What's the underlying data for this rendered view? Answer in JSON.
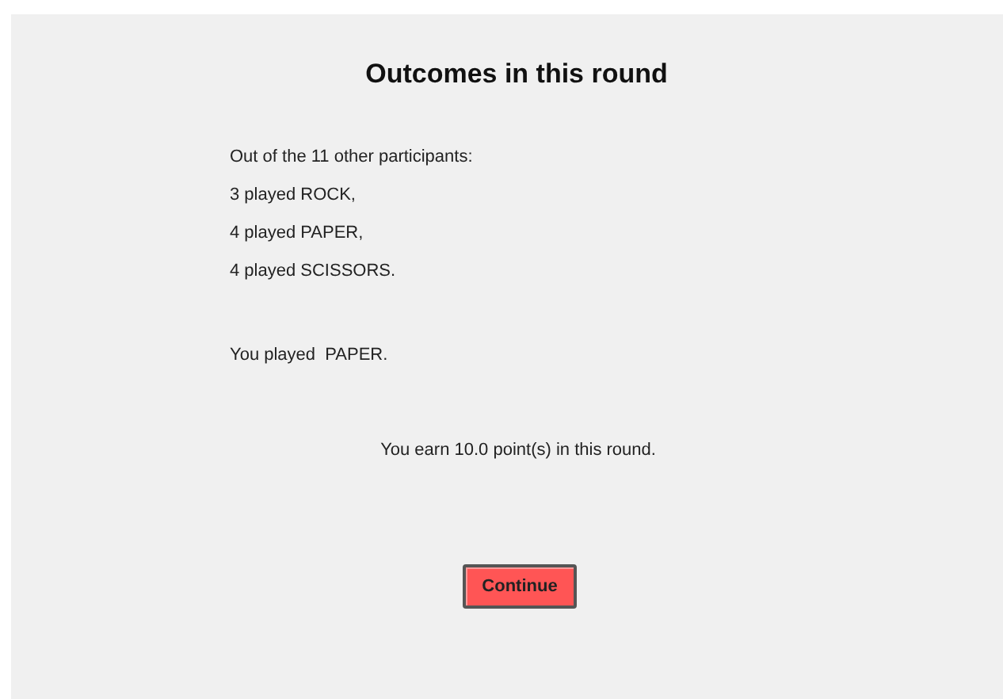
{
  "title": "Outcomes in this round",
  "summary_lines": [
    "Out of the 11 other participants:",
    "3 played ROCK,",
    "4 played PAPER,",
    "4 played SCISSORS."
  ],
  "own_choice": "You played  PAPER.",
  "earnings": "You earn 10.0 point(s) in this round.",
  "button": "Continue"
}
